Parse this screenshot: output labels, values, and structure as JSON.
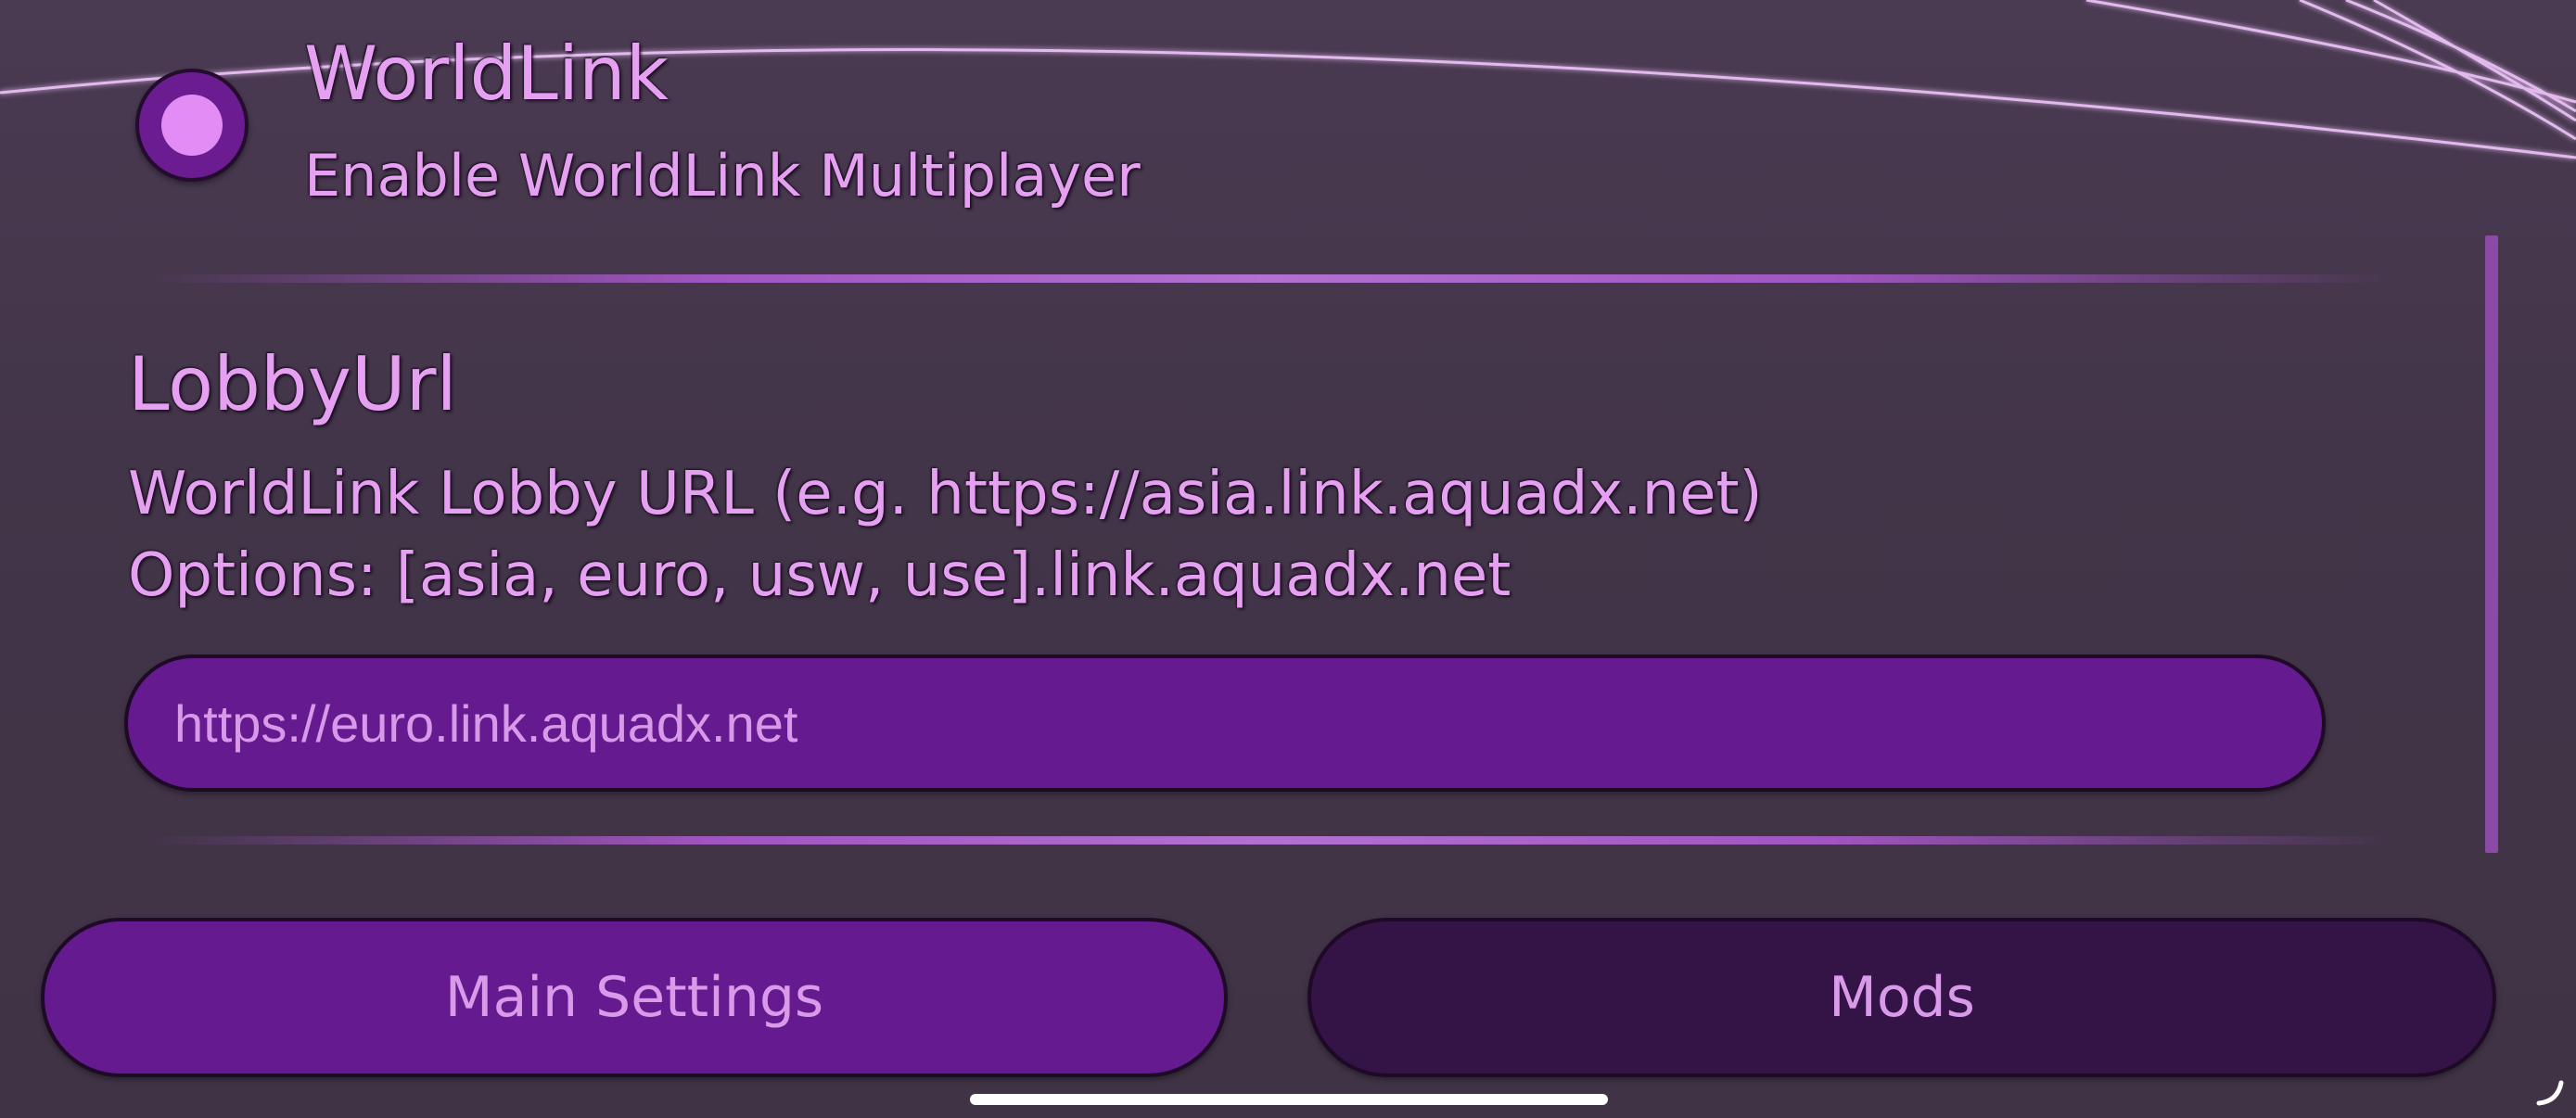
{
  "header": {
    "title": "WorldLink",
    "subtitle": "Enable WorldLink Multiplayer",
    "toggle_enabled": true
  },
  "lobby": {
    "title": "LobbyUrl",
    "description_line1": "WorldLink Lobby URL (e.g. https://asia.link.aquadx.net)",
    "description_line2": "Options: [asia, euro, usw, use].link.aquadx.net",
    "url_value": "https://euro.link.aquadx.net"
  },
  "footer": {
    "main_settings_label": "Main Settings",
    "mods_label": "Mods",
    "active_tab": "Main Settings"
  },
  "icons": {
    "toggle": "radio-toggle-icon",
    "corner": "resize-corner-icon"
  },
  "colors": {
    "accent_text": "#e6a0f2",
    "active_fill": "#661a90",
    "inactive_fill": "#341346",
    "background": "#433549"
  }
}
